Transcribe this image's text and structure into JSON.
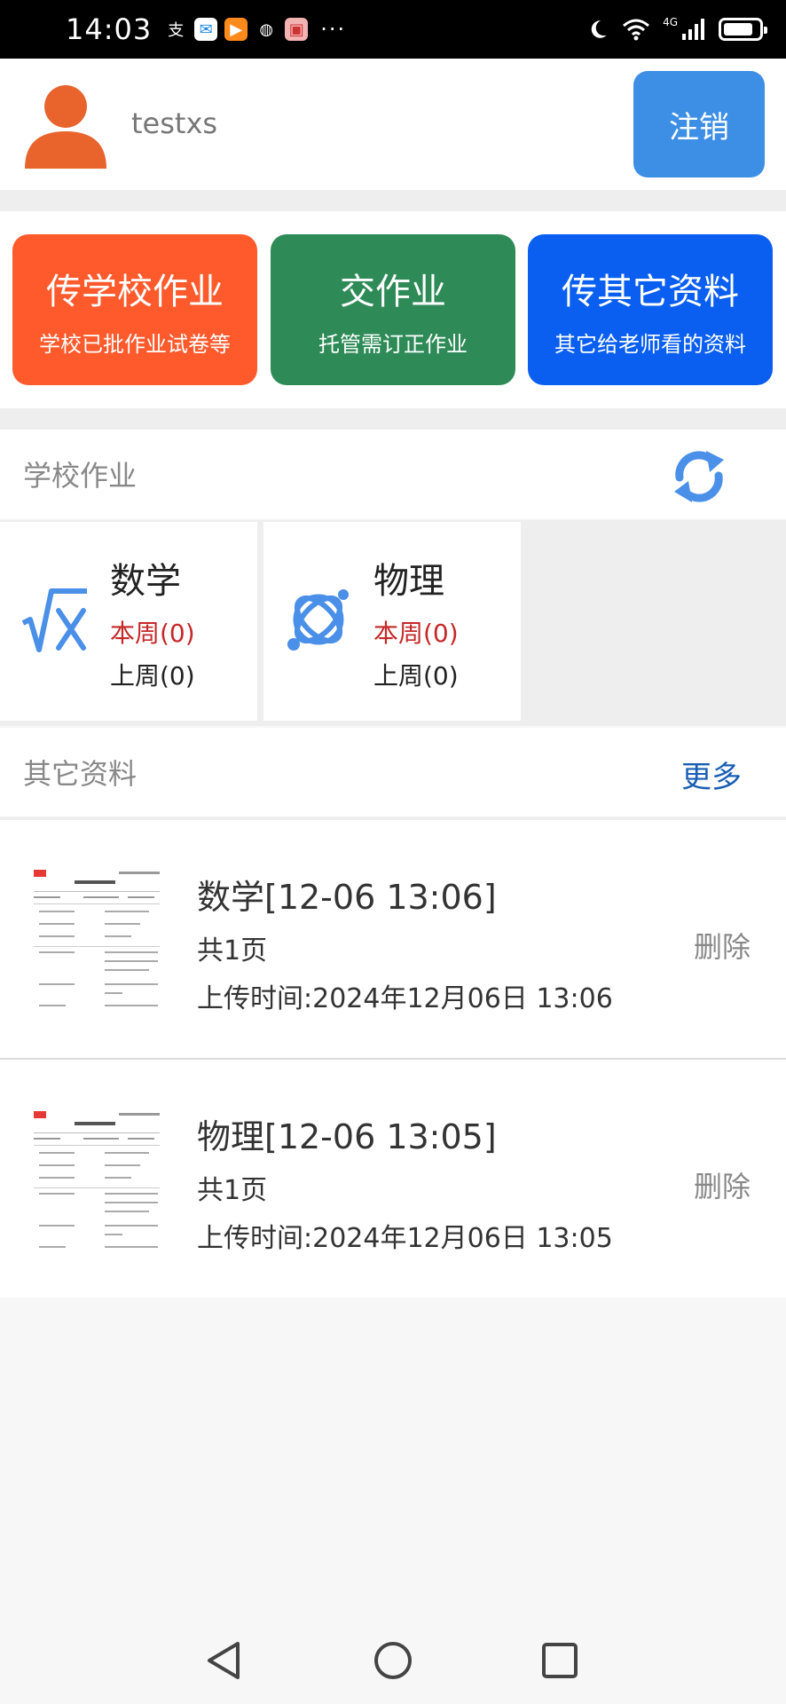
{
  "status_bar": {
    "time": "14:03",
    "app_icons": [
      {
        "name": "alipay-icon",
        "glyph": "支"
      },
      {
        "name": "chat-app-icon",
        "glyph": "✉"
      },
      {
        "name": "video-app-icon",
        "glyph": "▶"
      },
      {
        "name": "browser-app-icon",
        "glyph": "◍"
      },
      {
        "name": "shop-app-icon",
        "glyph": "▣"
      }
    ],
    "more_dots": "···",
    "network_label": "4G",
    "battery_level": 0.85
  },
  "user": {
    "username": "testxs",
    "logout_label": "注销",
    "avatar_color": "#e9632d"
  },
  "actions": [
    {
      "title": "传学校作业",
      "subtitle": "学校已批作业试卷等",
      "color": "#ff5a2c"
    },
    {
      "title": "交作业",
      "subtitle": "托管需订正作业",
      "color": "#2e8b57"
    },
    {
      "title": "传其它资料",
      "subtitle": "其它给老师看的资料",
      "color": "#0a5ff0"
    }
  ],
  "school_homework": {
    "title": "学校作业",
    "subjects": [
      {
        "name": "数学",
        "this_week": "本周(0)",
        "last_week": "上周(0)",
        "icon": "sqrt-x-icon"
      },
      {
        "name": "物理",
        "this_week": "本周(0)",
        "last_week": "上周(0)",
        "icon": "atom-icon"
      }
    ]
  },
  "other_materials": {
    "title": "其它资料",
    "more_label": "更多",
    "items": [
      {
        "title": "数学[12-06 13:06]",
        "pages": "共1页",
        "upload_time": "上传时间:2024年12月06日 13:06",
        "delete_label": "删除"
      },
      {
        "title": "物理[12-06 13:05]",
        "pages": "共1页",
        "upload_time": "上传时间:2024年12月06日 13:05",
        "delete_label": "删除"
      }
    ]
  },
  "colors": {
    "accent_blue": "#3d8fe6",
    "icon_blue": "#4a8fe8",
    "this_week_red": "#c62828",
    "more_link_blue": "#1a5fb4"
  }
}
